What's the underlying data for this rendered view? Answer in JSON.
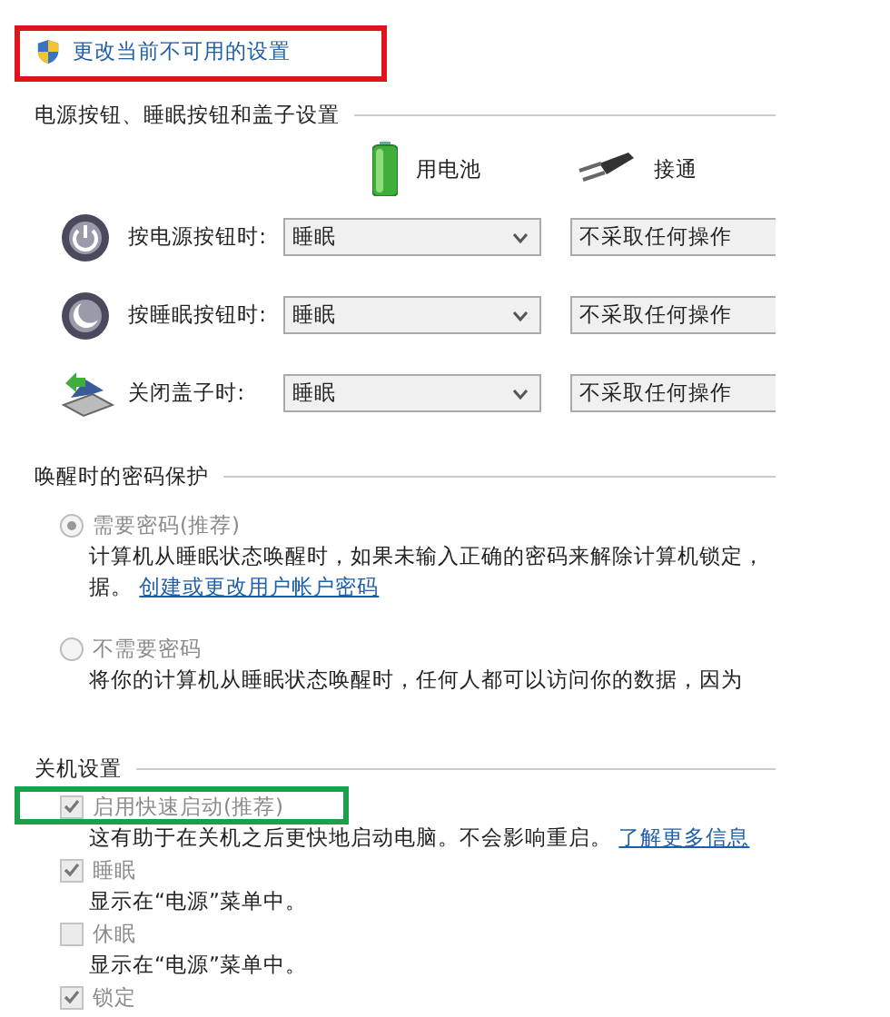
{
  "change_settings_link": "更改当前不可用的设置",
  "buttons_section": {
    "title": "电源按钮、睡眠按钮和盖子设置",
    "columns": [
      {
        "kind": "battery",
        "label": "用电池"
      },
      {
        "kind": "plugged",
        "label": "接通"
      }
    ],
    "rows": [
      {
        "kind": "power",
        "label": "按电源按钮时:",
        "values": [
          "睡眠",
          "不采取任何操作"
        ]
      },
      {
        "kind": "sleep",
        "label": "按睡眠按钮时:",
        "values": [
          "睡眠",
          "不采取任何操作"
        ]
      },
      {
        "kind": "lid",
        "label": "关闭盖子时:",
        "values": [
          "睡眠",
          "不采取任何操作"
        ]
      }
    ]
  },
  "password_section": {
    "title": "唤醒时的密码保护",
    "options": [
      {
        "label": "需要密码(推荐)",
        "selected": true,
        "disabled": true,
        "description": "计算机从睡眠状态唤醒时，如果未输入正确的密码来解除计算机锁定，",
        "description_2": "据。",
        "link": "创建或更改用户帐户密码"
      },
      {
        "label": "不需要密码",
        "selected": false,
        "disabled": true,
        "description": "将你的计算机从睡眠状态唤醒时，任何人都可以访问你的数据，因为"
      }
    ]
  },
  "shutdown_section": {
    "title": "关机设置",
    "options": [
      {
        "label": "启用快速启动(推荐)",
        "checked": true,
        "disabled": true,
        "description": "这有助于在关机之后更快地启动电脑。不会影响重启。",
        "link": "了解更多信息"
      },
      {
        "label": "睡眠",
        "checked": true,
        "disabled": true,
        "description": "显示在“电源”菜单中。"
      },
      {
        "label": "休眠",
        "checked": false,
        "disabled": true,
        "description": "显示在“电源”菜单中。"
      },
      {
        "label": "锁定",
        "checked": true,
        "disabled": true
      }
    ]
  }
}
